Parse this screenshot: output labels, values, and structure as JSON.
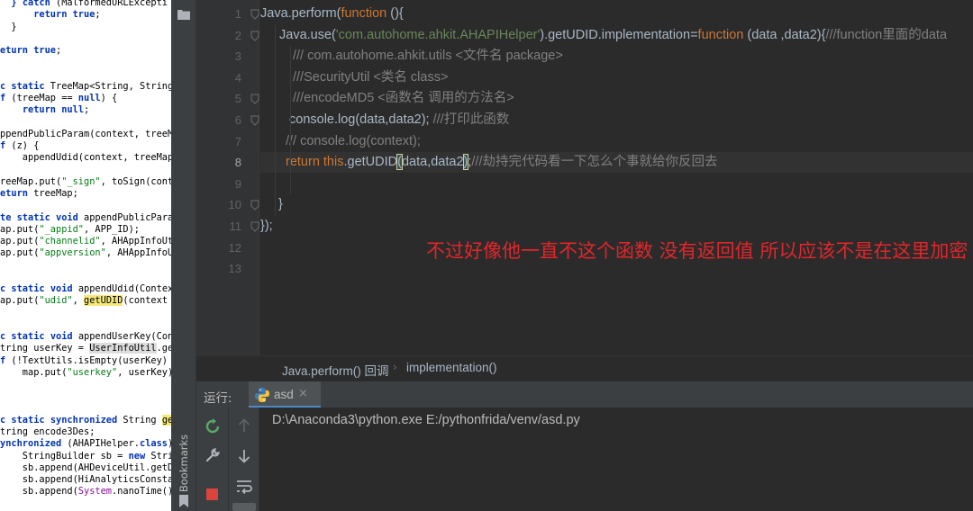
{
  "left_panel": {
    "lines": [
      {
        "html": "  <span class=\"k\">}</span> <span class=\"k\">catch</span> (MalformedURLExcepti"
      },
      {
        "html": "      <span class=\"k\">return</span> <span class=\"k\">true</span>;"
      },
      {
        "html": "  }"
      },
      {
        "html": ""
      },
      {
        "html": "<span class=\"k\">eturn</span> <span class=\"k\">true</span>;"
      },
      {
        "html": ""
      },
      {
        "html": ""
      },
      {
        "html": "<span class=\"k\">c</span> <span class=\"k\">static</span> TreeMap&lt;String, String"
      },
      {
        "html": "<span class=\"k\">f</span> (treeMap == <span class=\"k\">null</span>) {"
      },
      {
        "html": "    <span class=\"k\">return</span> <span class=\"k\">null</span>;"
      },
      {
        "html": ""
      },
      {
        "html": "ppendPublicParam(context, treeM"
      },
      {
        "html": "<span class=\"k\">f</span> (z) {"
      },
      {
        "html": "    appendUdid(context, treeMap)"
      },
      {
        "html": ""
      },
      {
        "html": "reeMap.put(<span class=\"s\">\"_sign\"</span>, toSign(cont"
      },
      {
        "html": "<span class=\"k\">eturn</span> treeMap;"
      },
      {
        "html": ""
      },
      {
        "html": "<span class=\"k\">te</span> <span class=\"k\">static</span> <span class=\"k\">void</span> appendPublicPara"
      },
      {
        "html": "ap.put(<span class=\"s\">\"_appid\"</span>, APP_ID);"
      },
      {
        "html": "ap.put(<span class=\"s\">\"channelid\"</span>, AHAppInfoUt"
      },
      {
        "html": "ap.put(<span class=\"s\">\"appversion\"</span>, AHAppInfoU"
      },
      {
        "html": ""
      },
      {
        "html": ""
      },
      {
        "html": "<span class=\"k\">c</span> <span class=\"k\">static</span> <span class=\"k\">void</span> appendUdid(Contex"
      },
      {
        "html": "ap.put(<span class=\"s\">\"udid\"</span>, <span class=\"hl-y\">getUDID</span>(context"
      },
      {
        "html": ""
      },
      {
        "html": ""
      },
      {
        "html": "<span class=\"k\">c</span> <span class=\"k\">static</span> <span class=\"k\">void</span> appendUserKey(Con"
      },
      {
        "html": "tring userKey = <span class=\"hl-g\">UserInfoUtil</span>.ge"
      },
      {
        "html": "<span class=\"k\">f</span> (!TextUtils.isEmpty(userKey)"
      },
      {
        "html": "    map.put(<span class=\"s\">\"userkey\"</span>, userKey);"
      },
      {
        "html": ""
      },
      {
        "html": ""
      },
      {
        "html": ""
      },
      {
        "html": "<span class=\"k\">c</span> <span class=\"k\">static</span> <span class=\"k\">synchronized</span> String <span class=\"hl-y\">ge</span>"
      },
      {
        "html": "tring encode3Des;"
      },
      {
        "html": "<span class=\"k\">ynchronized</span> (AHAPIHelper.<span class=\"k\">class</span>)"
      },
      {
        "html": "    StringBuilder sb = <span class=\"k\">new</span> Strin"
      },
      {
        "html": "    sb.append(AHDeviceUtil.getDe"
      },
      {
        "html": "    sb.append(HiAnalyticsConstan"
      },
      {
        "html": "    sb.append(<span class=\"f\">System</span>.nanoTime()"
      }
    ]
  },
  "editor": {
    "line_numbers": [
      "1",
      "2",
      "3",
      "4",
      "5",
      "6",
      "7",
      "8",
      "9",
      "10",
      "11",
      "12",
      "13"
    ],
    "current_line": 8,
    "lines": [
      {
        "n": 1,
        "indent": 0,
        "html": "<span class=\"id\">Java.perform(</span><span class=\"kw\">function</span><span class=\"id\"> (){</span>"
      },
      {
        "n": 2,
        "indent": 1,
        "html": "<span class=\"id\">Java.use(</span><span class=\"str\">'com.autohome.ahkit.AHAPIHelper'</span><span class=\"id\">).getUDID.implementation=</span><span class=\"kw\">function</span><span class=\"id\"> (data ,data2){</span><span class=\"cm\">///function里面的data</span>"
      },
      {
        "n": 3,
        "indent": 2,
        "html": "<span class=\"cm\">/// com.autohome.ahkit.utils &lt;文件名 package&gt;</span>"
      },
      {
        "n": 4,
        "indent": 2,
        "html": "<span class=\"cm\">///SecurityUtil &lt;类名 class&gt;</span>"
      },
      {
        "n": 5,
        "indent": 2,
        "html": "<span class=\"cm\">///encodeMD5 &lt;函数名 调用的方法名&gt;</span>"
      },
      {
        "n": 6,
        "indent": 3,
        "html": "<span class=\"id\">console.log(data,data2); </span><span class=\"cm\">///打印此函数</span>"
      },
      {
        "n": 7,
        "indent": 4,
        "html": "<span class=\"cm\">/// console.log(context);</span>"
      },
      {
        "n": 8,
        "indent": 5,
        "html": "<span class=\"kw\">return this</span><span class=\"id\">.getUDID</span><span class=\"brace-hl\">(</span><span class=\"id\">data,data2</span><span class=\"brace-hl\">)</span><span class=\"id\">;</span><span class=\"cm\">///劫持完代码看一下怎么个事就给你反回去</span>"
      },
      {
        "n": 9,
        "indent": 0,
        "html": ""
      },
      {
        "n": 10,
        "indent": 6,
        "html": "<span class=\"id\">}</span>"
      },
      {
        "n": 11,
        "indent": 0,
        "html": "<span class=\"id\">});</span>"
      },
      {
        "n": 12,
        "indent": 0,
        "html": ""
      },
      {
        "n": 13,
        "indent": 0,
        "html": ""
      }
    ],
    "annotation": "不过好像他一直不这个函数 没有返回值 所以应该不是在这里加密"
  },
  "breadcrumb": {
    "item1": "Java.perform() 回调",
    "separator": "›",
    "item2": "implementation()"
  },
  "run_panel": {
    "label": "运行:",
    "tab_name": "asd",
    "close_glyph": "×",
    "console_line": "D:\\Anaconda3\\python.exe E:/pythonfrida/venv/asd.py"
  },
  "sidebar": {
    "bookmarks_label": "Bookmarks"
  },
  "colors": {
    "editor_bg": "#2b2b2b",
    "keyword": "#cc7832",
    "string": "#6a8759",
    "comment": "#808080",
    "annotation_red": "#e2262a"
  }
}
